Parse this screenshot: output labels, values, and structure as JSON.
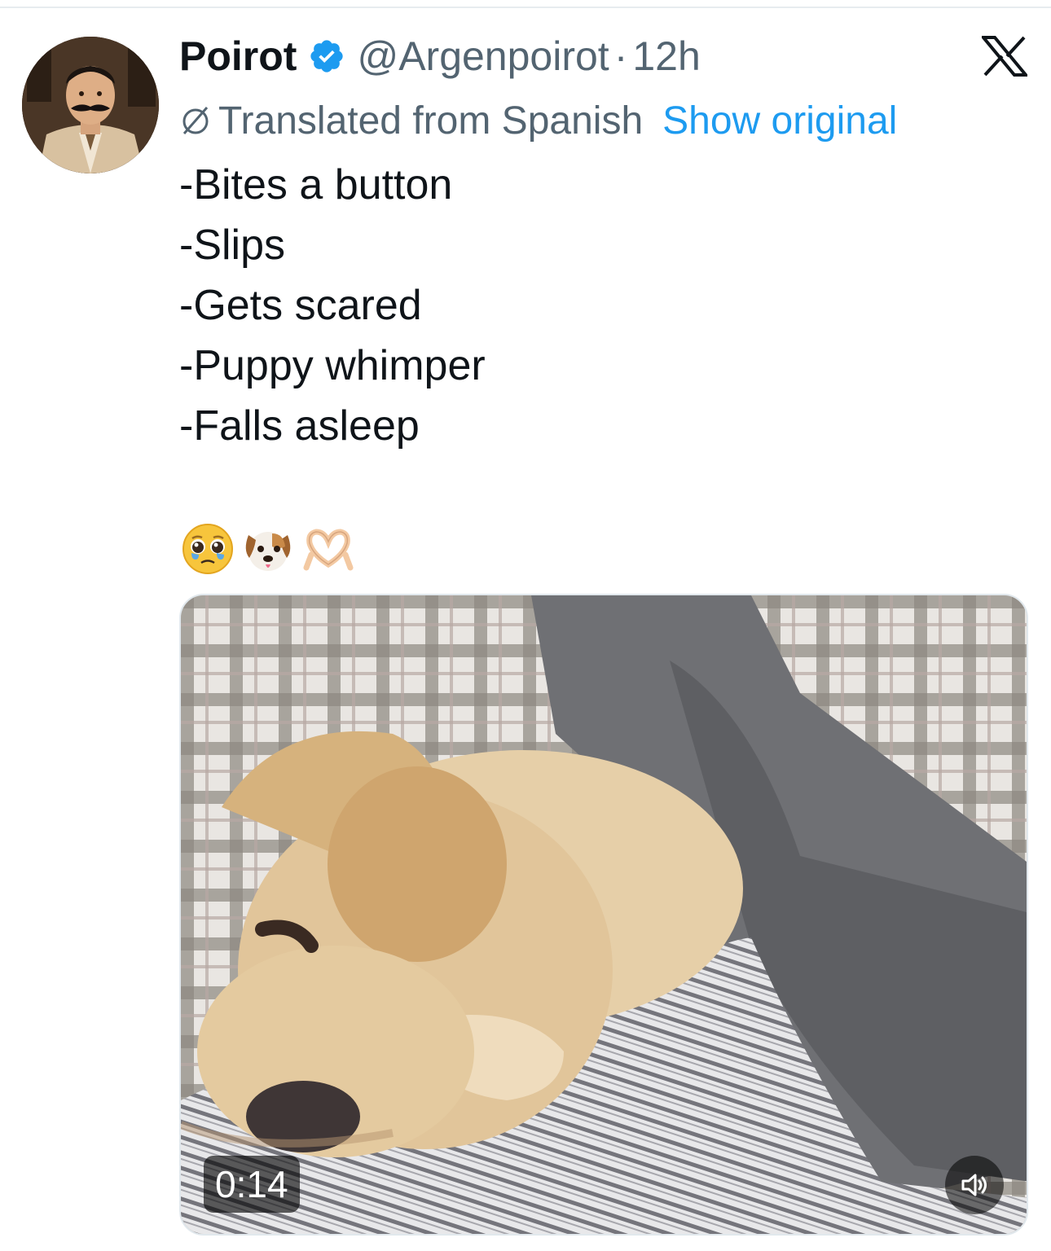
{
  "tweet": {
    "author": {
      "display_name": "Poirot",
      "handle": "@Argenpoirot",
      "verified": true,
      "avatar_icon": "avatar-portrait-mustached-man"
    },
    "separator": "·",
    "time": "12h",
    "brand_icon": "x-logo-icon",
    "translation": {
      "label": "Translated from Spanish",
      "action": "Show original",
      "icon": "globe-slash-icon"
    },
    "lines": [
      "-Bites a button",
      "-Slips",
      "-Gets scared",
      "-Puppy whimper",
      "-Falls asleep"
    ],
    "emojis": [
      "pleading-face-icon",
      "dog-face-icon",
      "heart-hands-icon"
    ],
    "media": {
      "type": "video",
      "subject": "puppy-sleeping-icon",
      "duration": "0:14",
      "volume_icon": "speaker-icon"
    }
  },
  "colors": {
    "primary_text": "#0f1419",
    "secondary_text": "#536471",
    "accent": "#1d9bf0",
    "verified_badge": "#1d9bf0"
  }
}
